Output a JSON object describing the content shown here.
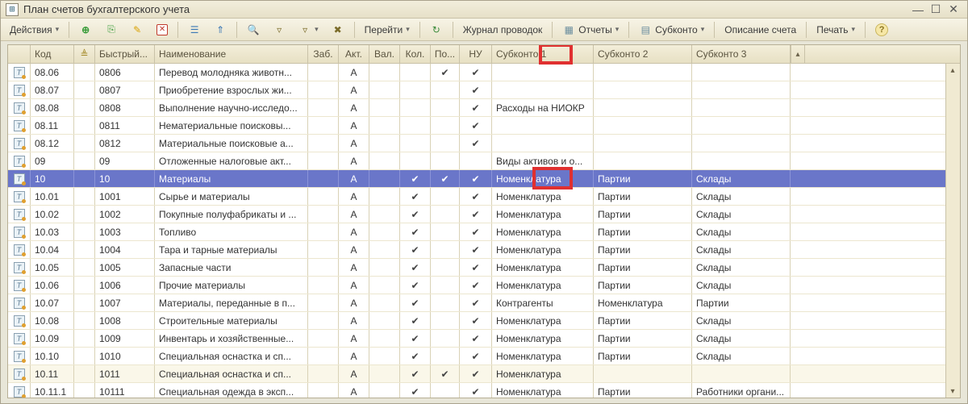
{
  "window": {
    "title": "План счетов бухгалтерского учета"
  },
  "toolbar": {
    "actions": "Действия",
    "goto": "Перейти",
    "journal": "Журнал проводок",
    "reports": "Отчеты",
    "subkonto": "Субконто",
    "desc": "Описание счета",
    "print": "Печать"
  },
  "columns": {
    "kod": "Код",
    "fast": "Быстрый...",
    "name": "Наименование",
    "zab": "Заб.",
    "akt": "Акт.",
    "val": "Вал.",
    "kol": "Кол.",
    "po": "По...",
    "nu": "НУ",
    "s1": "Субконто 1",
    "s2": "Субконто 2",
    "s3": "Субконто 3"
  },
  "rows": [
    {
      "kod": "08.06",
      "fast": "0806",
      "name": "Перевод молодняка животн...",
      "akt": "А",
      "val": "",
      "kol": "",
      "po": "✔",
      "nu": "✔",
      "s1": "",
      "s2": "",
      "s3": ""
    },
    {
      "kod": "08.07",
      "fast": "0807",
      "name": "Приобретение взрослых жи...",
      "akt": "А",
      "val": "",
      "kol": "",
      "po": "",
      "nu": "✔",
      "s1": "",
      "s2": "",
      "s3": ""
    },
    {
      "kod": "08.08",
      "fast": "0808",
      "name": "Выполнение научно-исследо...",
      "akt": "А",
      "val": "",
      "kol": "",
      "po": "",
      "nu": "✔",
      "s1": "Расходы на НИОКР",
      "s2": "",
      "s3": ""
    },
    {
      "kod": "08.11",
      "fast": "0811",
      "name": "Нематериальные поисковы...",
      "akt": "А",
      "val": "",
      "kol": "",
      "po": "",
      "nu": "✔",
      "s1": "",
      "s2": "",
      "s3": ""
    },
    {
      "kod": "08.12",
      "fast": "0812",
      "name": "Материальные поисковые а...",
      "akt": "А",
      "val": "",
      "kol": "",
      "po": "",
      "nu": "✔",
      "s1": "",
      "s2": "",
      "s3": ""
    },
    {
      "kod": "09",
      "fast": "09",
      "name": "Отложенные налоговые акт...",
      "akt": "А",
      "val": "",
      "kol": "",
      "po": "",
      "nu": "",
      "s1": "Виды активов и о...",
      "s2": "",
      "s3": ""
    },
    {
      "kod": "10",
      "fast": "10",
      "name": "Материалы",
      "akt": "А",
      "val": "",
      "kol": "✔",
      "po": "✔",
      "nu": "✔",
      "s1": "Номенклатура",
      "s2": "Партии",
      "s3": "Склады",
      "selected": true
    },
    {
      "kod": "10.01",
      "fast": "1001",
      "name": "Сырье и материалы",
      "akt": "А",
      "val": "",
      "kol": "✔",
      "po": "",
      "nu": "✔",
      "s1": "Номенклатура",
      "s2": "Партии",
      "s3": "Склады"
    },
    {
      "kod": "10.02",
      "fast": "1002",
      "name": "Покупные полуфабрикаты и ...",
      "akt": "А",
      "val": "",
      "kol": "✔",
      "po": "",
      "nu": "✔",
      "s1": "Номенклатура",
      "s2": "Партии",
      "s3": "Склады"
    },
    {
      "kod": "10.03",
      "fast": "1003",
      "name": "Топливо",
      "akt": "А",
      "val": "",
      "kol": "✔",
      "po": "",
      "nu": "✔",
      "s1": "Номенклатура",
      "s2": "Партии",
      "s3": "Склады"
    },
    {
      "kod": "10.04",
      "fast": "1004",
      "name": "Тара и тарные материалы",
      "akt": "А",
      "val": "",
      "kol": "✔",
      "po": "",
      "nu": "✔",
      "s1": "Номенклатура",
      "s2": "Партии",
      "s3": "Склады"
    },
    {
      "kod": "10.05",
      "fast": "1005",
      "name": "Запасные части",
      "akt": "А",
      "val": "",
      "kol": "✔",
      "po": "",
      "nu": "✔",
      "s1": "Номенклатура",
      "s2": "Партии",
      "s3": "Склады"
    },
    {
      "kod": "10.06",
      "fast": "1006",
      "name": "Прочие материалы",
      "akt": "А",
      "val": "",
      "kol": "✔",
      "po": "",
      "nu": "✔",
      "s1": "Номенклатура",
      "s2": "Партии",
      "s3": "Склады"
    },
    {
      "kod": "10.07",
      "fast": "1007",
      "name": "Материалы, переданные в п...",
      "akt": "А",
      "val": "",
      "kol": "✔",
      "po": "",
      "nu": "✔",
      "s1": "Контрагенты",
      "s2": "Номенклатура",
      "s3": "Партии"
    },
    {
      "kod": "10.08",
      "fast": "1008",
      "name": "Строительные материалы",
      "akt": "А",
      "val": "",
      "kol": "✔",
      "po": "",
      "nu": "✔",
      "s1": "Номенклатура",
      "s2": "Партии",
      "s3": "Склады"
    },
    {
      "kod": "10.09",
      "fast": "1009",
      "name": "Инвентарь и хозяйственные...",
      "akt": "А",
      "val": "",
      "kol": "✔",
      "po": "",
      "nu": "✔",
      "s1": "Номенклатура",
      "s2": "Партии",
      "s3": "Склады"
    },
    {
      "kod": "10.10",
      "fast": "1010",
      "name": "Специальная оснастка и сп...",
      "akt": "А",
      "val": "",
      "kol": "✔",
      "po": "",
      "nu": "✔",
      "s1": "Номенклатура",
      "s2": "Партии",
      "s3": "Склады"
    },
    {
      "kod": "10.11",
      "fast": "1011",
      "name": "Специальная оснастка и сп...",
      "akt": "А",
      "val": "",
      "kol": "✔",
      "po": "✔",
      "nu": "✔",
      "s1": "Номенклатура",
      "s2": "",
      "s3": "",
      "alt": true
    },
    {
      "kod": "10.11.1",
      "fast": "10111",
      "name": "Специальная одежда в эксп...",
      "akt": "А",
      "val": "",
      "kol": "✔",
      "po": "",
      "nu": "✔",
      "s1": "Номенклатура",
      "s2": "Партии",
      "s3": "Работники органи..."
    }
  ]
}
